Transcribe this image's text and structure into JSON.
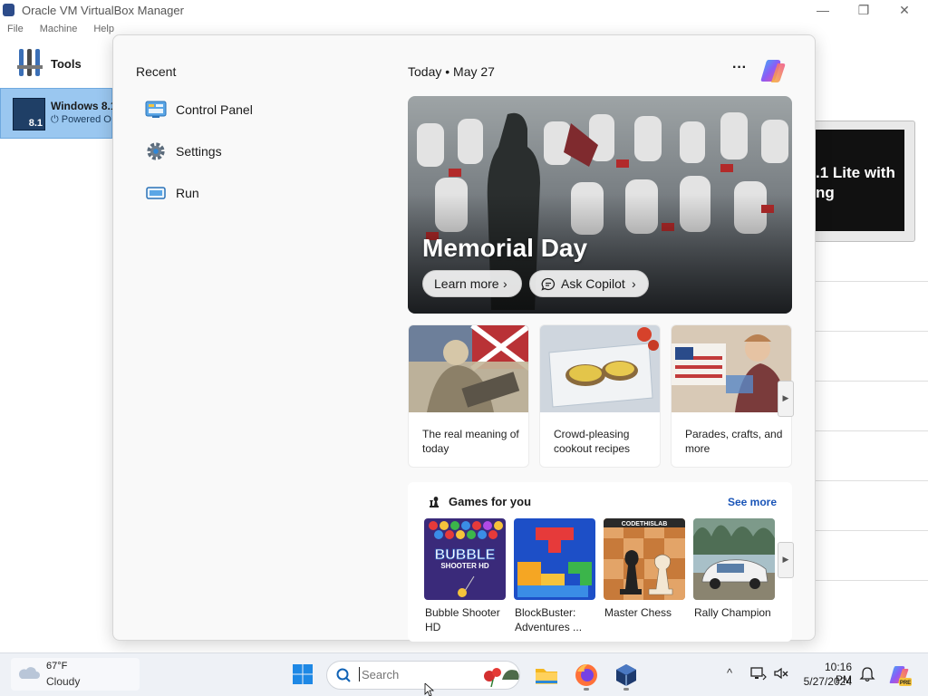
{
  "vbox": {
    "title": "Oracle VM VirtualBox Manager",
    "menu": [
      "File",
      "Machine",
      "Help"
    ],
    "controls": {
      "minimize": "—",
      "restore": "❐",
      "close": "✕"
    },
    "tools_label": "Tools",
    "vm_name": "Windows 8.1",
    "vm_state": "Powered O",
    "vm_badge": "8.1",
    "preview_lines": [
      ".1 Lite with",
      "ng"
    ]
  },
  "start": {
    "recent_title": "Recent",
    "recent": [
      {
        "label": "Control Panel",
        "icon": "control-panel-icon"
      },
      {
        "label": "Settings",
        "icon": "gear-icon"
      },
      {
        "label": "Run",
        "icon": "run-icon"
      }
    ],
    "today_label": "Today",
    "today_sep": "•",
    "today_date": "May 27",
    "more_label": "···",
    "hero": {
      "title": "Memorial Day",
      "learn_more": "Learn more",
      "ask_copilot": "Ask Copilot"
    },
    "cards": [
      {
        "caption": "The real meaning of today"
      },
      {
        "caption": "Crowd-pleasing cookout recipes"
      },
      {
        "caption": "Parades, crafts, and more"
      }
    ],
    "games": {
      "title": "Games for you",
      "see_more": "See more",
      "tile1_text": "BUBBLE",
      "tile1_text2": "SHOOTER HD",
      "tile3_brand": "CODETHISLAB",
      "items": [
        {
          "caption": "Bubble Shooter HD"
        },
        {
          "caption": "BlockBuster: Adventures ..."
        },
        {
          "caption": "Master Chess"
        },
        {
          "caption": "Rally Champion"
        }
      ]
    }
  },
  "taskbar": {
    "weather_temp": "67°F",
    "weather_cond": "Cloudy",
    "search_placeholder": "Search",
    "clock_time": "10:16 PM",
    "clock_date": "5/27/2024",
    "copilot_badge": "PRE"
  },
  "colors": {
    "accent": "#0067c0",
    "vm_selected": "#9ac7f0",
    "link": "#1a55b8"
  }
}
